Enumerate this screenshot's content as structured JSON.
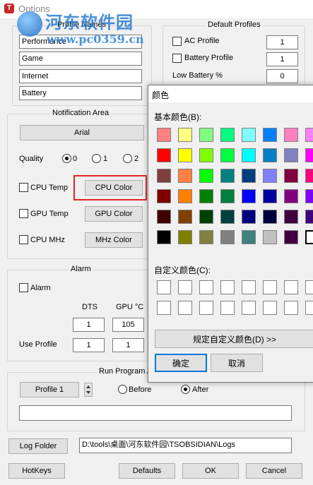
{
  "window": {
    "title": "Options",
    "icon_letter": "T"
  },
  "watermark": {
    "logo_text": "河东软件园",
    "url": "www.pc0359.cn"
  },
  "profile_names": {
    "label": "Profile Names",
    "values": [
      "Performance",
      "Game",
      "Internet",
      "Battery"
    ]
  },
  "default_profiles": {
    "label": "Default Profiles",
    "ac_profile": {
      "label": "AC Profile",
      "value": "1"
    },
    "battery_profile": {
      "label": "Battery Profile",
      "value": "1"
    },
    "low_battery": {
      "label": "Low Battery %",
      "value": "0"
    }
  },
  "notification_area": {
    "label": "Notification Area",
    "font_button": "Arial",
    "quality": {
      "label": "Quality",
      "options": [
        "0",
        "1",
        "2"
      ],
      "selected": "0"
    },
    "cpu_temp": {
      "label": "CPU Temp",
      "button": "CPU Color"
    },
    "gpu_temp": {
      "label": "GPU Temp",
      "button": "GPU Color"
    },
    "cpu_mhz": {
      "label": "CPU MHz",
      "button": "MHz Color"
    }
  },
  "alarm": {
    "label": "Alarm",
    "checkbox": "Alarm",
    "col_dts": "DTS",
    "col_gpu": "GPU °C",
    "dts_value": "1",
    "gpu_value": "105",
    "use_profile": {
      "label": "Use Profile",
      "dts": "1",
      "gpu": "1"
    }
  },
  "run_program": {
    "label": "Run Program A",
    "profile_button": "Profile 1",
    "before": "Before",
    "after": "After",
    "selected": "After",
    "path": ""
  },
  "log_folder": {
    "button": "Log Folder",
    "path": "D:\\tools\\桌面\\河东软件园\\TSOBSIDIAN\\Logs"
  },
  "bottom": {
    "hotkeys": "HotKeys",
    "defaults": "Defaults",
    "ok": "OK",
    "cancel": "Cancel"
  },
  "color_dialog": {
    "title": "颜色",
    "basic_colors_label": "基本颜色(B):",
    "custom_colors_label": "自定义颜色(C):",
    "define_custom": "规定自定义颜色(D) >>",
    "ok": "确定",
    "cancel": "取消",
    "basic_colors": [
      [
        "#ff8080",
        "#ffff80",
        "#80ff80",
        "#00ff80",
        "#80ffff",
        "#0080ff",
        "#ff80c0",
        "#ff80ff"
      ],
      [
        "#ff0000",
        "#ffff00",
        "#80ff00",
        "#00ff40",
        "#00ffff",
        "#0080c0",
        "#8080c0",
        "#ff00ff"
      ],
      [
        "#804040",
        "#ff8040",
        "#00ff00",
        "#008080",
        "#004080",
        "#8080ff",
        "#800040",
        "#ff0080"
      ],
      [
        "#800000",
        "#ff8000",
        "#008000",
        "#008040",
        "#0000ff",
        "#0000a0",
        "#800080",
        "#8000ff"
      ],
      [
        "#400000",
        "#804000",
        "#004000",
        "#004040",
        "#000080",
        "#000040",
        "#400040",
        "#400080"
      ],
      [
        "#000000",
        "#808000",
        "#808040",
        "#808080",
        "#408080",
        "#c0c0c0",
        "#400040",
        "#ffffff"
      ]
    ]
  }
}
